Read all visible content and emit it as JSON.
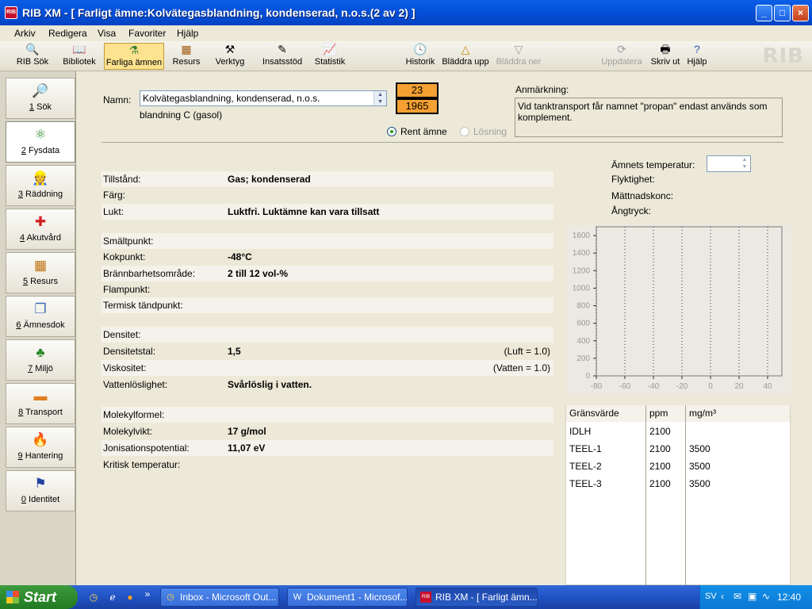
{
  "window": {
    "title": "RIB XM - [ Farligt ämne:Kolvätegasblandning, kondenserad, n.o.s.(2 av 2) ]",
    "app_icon": "RIB"
  },
  "menu": [
    "Arkiv",
    "Redigera",
    "Visa",
    "Favoriter",
    "Hjälp"
  ],
  "toolbar": {
    "items": [
      {
        "label": "RIB Sök",
        "icon": "search-person-icon"
      },
      {
        "label": "Bibliotek",
        "icon": "book-icon"
      },
      {
        "label": "Farliga ämnen",
        "icon": "flask-icon"
      },
      {
        "label": "Resurs",
        "icon": "truck-icon"
      },
      {
        "label": "Verktyg",
        "icon": "tools-icon"
      },
      {
        "label": "Insatsstöd",
        "icon": "checklist-icon"
      },
      {
        "label": "Statistik",
        "icon": "chart-icon"
      }
    ],
    "nav_items": [
      {
        "label": "Historik",
        "icon": "clock-icon"
      },
      {
        "label": "Bläddra upp",
        "icon": "triangle-up-icon"
      },
      {
        "label": "Bläddra ner",
        "icon": "triangle-down-icon"
      }
    ],
    "right_items": [
      {
        "label": "Uppdatera",
        "icon": "refresh-icon"
      },
      {
        "label": "Skriv ut",
        "icon": "printer-icon"
      },
      {
        "label": "Hjälp",
        "icon": "help-icon"
      }
    ],
    "logo": "RIB"
  },
  "sidebar": {
    "items": [
      {
        "key": "1",
        "label": " Sök",
        "icon": "magnifier-icon"
      },
      {
        "key": "2",
        "label": " Fysdata",
        "icon": "molecule-icon"
      },
      {
        "key": "3",
        "label": " Räddning",
        "icon": "firefighter-icon"
      },
      {
        "key": "4",
        "label": " Akutvård",
        "icon": "medical-cross-icon"
      },
      {
        "key": "5",
        "label": " Resurs",
        "icon": "equipment-icon"
      },
      {
        "key": "6",
        "label": " Ämnesdok",
        "icon": "documents-icon"
      },
      {
        "key": "7",
        "label": " Miljö",
        "icon": "tree-icon"
      },
      {
        "key": "8",
        "label": " Transport",
        "icon": "hazard-plate-icon"
      },
      {
        "key": "9",
        "label": " Hantering",
        "icon": "fire-sign-icon"
      },
      {
        "key": "0",
        "label": " Identitet",
        "icon": "flags-icon"
      }
    ]
  },
  "header": {
    "name_label": "Namn:",
    "name_value": "Kolvätegasblandning, kondenserad, n.o.s.",
    "name_sub": "blandning C (gasol)",
    "un_hazard_number": "23",
    "un_number": "1965",
    "radio_pure": "Rent ämne",
    "radio_solution": "Lösning",
    "remark_label": "Anmärkning:",
    "remark_text": "Vid tanktransport får namnet \"propan\" endast används som komplement."
  },
  "properties": {
    "group1": [
      {
        "k": "Tillstånd:",
        "v": "Gas; kondenserad",
        "u": ""
      },
      {
        "k": "Färg:",
        "v": "",
        "u": ""
      },
      {
        "k": "Lukt:",
        "v": "Luktfri. Luktämne kan vara tillsatt",
        "u": ""
      }
    ],
    "group2": [
      {
        "k": "Smältpunkt:",
        "v": "",
        "u": ""
      },
      {
        "k": "Kokpunkt:",
        "v": "-48°C",
        "u": ""
      },
      {
        "k": "Brännbarhetsområde:",
        "v": "2 till 12 vol-%",
        "u": ""
      },
      {
        "k": "Flampunkt:",
        "v": "",
        "u": ""
      },
      {
        "k": "Termisk tändpunkt:",
        "v": "",
        "u": ""
      }
    ],
    "group3": [
      {
        "k": "Densitet:",
        "v": "",
        "u": ""
      },
      {
        "k": "Densitetstal:",
        "v": "1,5",
        "u": "(Luft = 1.0)"
      },
      {
        "k": "Viskositet:",
        "v": "",
        "u": "(Vatten = 1.0)"
      },
      {
        "k": "Vattenlöslighet:",
        "v": "Svårlöslig i vatten.",
        "u": ""
      }
    ],
    "group4": [
      {
        "k": "Molekylformel:",
        "v": "",
        "u": ""
      },
      {
        "k": "Molekylvikt:",
        "v": "17 g/mol",
        "u": ""
      },
      {
        "k": "Jonisationspotential:",
        "v": "11,07 eV",
        "u": ""
      },
      {
        "k": "Kritisk temperatur:",
        "v": "",
        "u": ""
      }
    ]
  },
  "temperature_panel": {
    "temp_label": "Ämnets temperatur:",
    "temp_value": "",
    "volatility_label": "Flyktighet:",
    "saturation_label": "Mättnadskonc:",
    "vapor_pressure_label": "Ångtryck:"
  },
  "chart_data": {
    "type": "line",
    "x": [],
    "values": [],
    "xlim": [
      -80,
      50
    ],
    "ylim": [
      0,
      1700
    ],
    "xticks": [
      -80,
      -60,
      -40,
      -20,
      0,
      20,
      40
    ],
    "yticks": [
      0,
      200,
      400,
      600,
      800,
      1000,
      1200,
      1400,
      1600
    ],
    "grid": true
  },
  "limit_table": {
    "headers": [
      "Gränsvärde",
      "ppm",
      "mg/m³"
    ],
    "rows": [
      [
        "IDLH",
        "2100",
        ""
      ],
      [
        "TEEL-1",
        "2100",
        "3500"
      ],
      [
        "TEEL-2",
        "2100",
        "3500"
      ],
      [
        "TEEL-3",
        "2100",
        "3500"
      ]
    ]
  },
  "taskbar": {
    "start": "Start",
    "quick_launch_more": "»",
    "items": [
      {
        "label": "Inbox - Microsoft Out...",
        "icon": "outlook-icon"
      },
      {
        "label": "Dokument1 - Microsof...",
        "icon": "word-icon"
      },
      {
        "label": "RIB XM - [ Farligt ämn...",
        "icon": "rib-icon"
      }
    ],
    "language": "SV",
    "clock": "12:40"
  },
  "colors": {
    "un_plate": "#f4a033",
    "title_bar": "#0550d9",
    "active_tool": "#fde28f"
  }
}
